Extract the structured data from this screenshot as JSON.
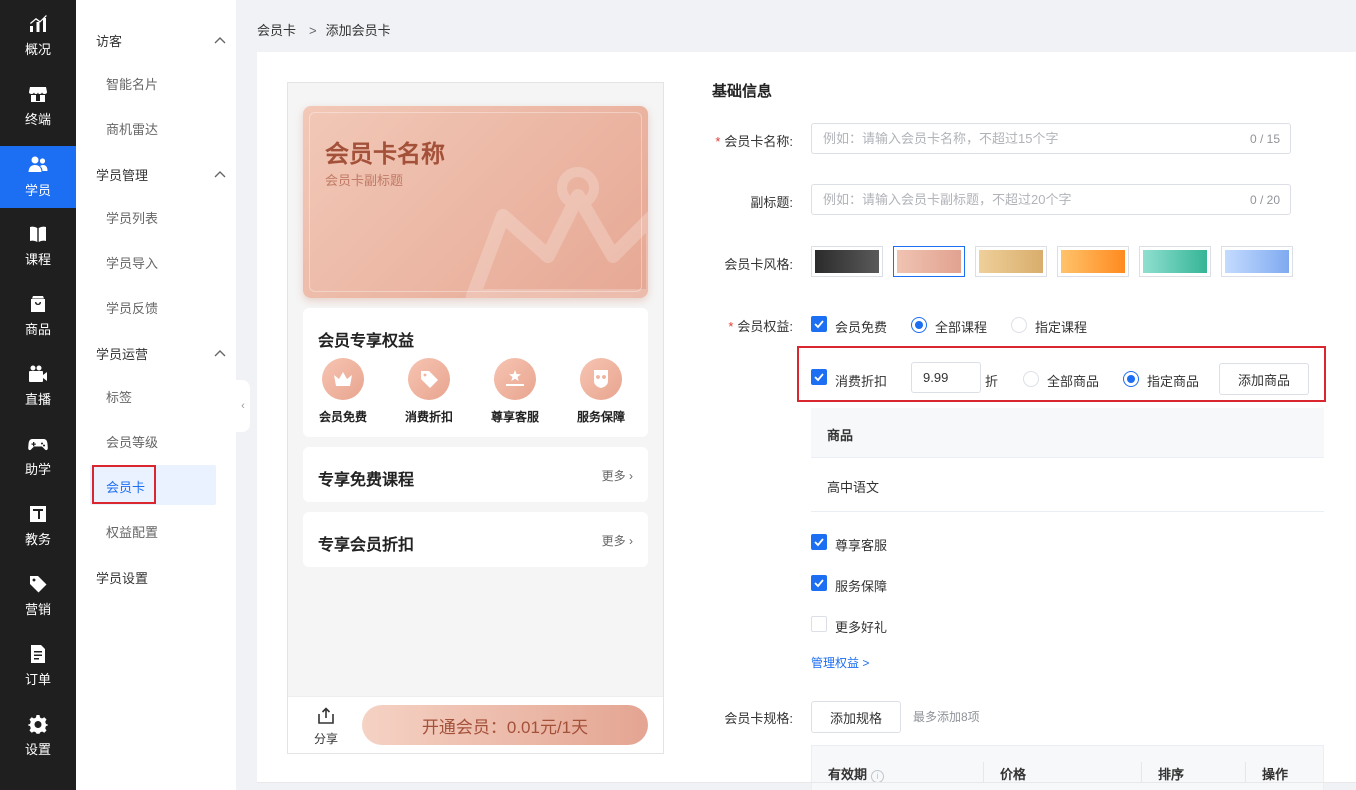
{
  "nav": {
    "items": [
      {
        "label": "概况",
        "icon": "chart-icon"
      },
      {
        "label": "终端",
        "icon": "store-icon"
      },
      {
        "label": "学员",
        "icon": "users-icon"
      },
      {
        "label": "课程",
        "icon": "book-icon"
      },
      {
        "label": "商品",
        "icon": "bag-icon"
      },
      {
        "label": "直播",
        "icon": "video-icon"
      },
      {
        "label": "助学",
        "icon": "gamepad-icon"
      },
      {
        "label": "教务",
        "icon": "board-icon"
      },
      {
        "label": "营销",
        "icon": "tag-icon"
      },
      {
        "label": "订单",
        "icon": "document-icon"
      },
      {
        "label": "设置",
        "icon": "gear-icon"
      }
    ],
    "active": "学员",
    "active_color": "#1c6ef2"
  },
  "submenu": {
    "group_visitor": "访客",
    "visitor_items": [
      "智能名片",
      "商机雷达"
    ],
    "group_student_mgmt": "学员管理",
    "mgmt_items": [
      "学员列表",
      "学员导入",
      "学员反馈"
    ],
    "group_student_ops": "学员运营",
    "ops_items": [
      "标签",
      "会员等级",
      "会员卡",
      "权益配置"
    ],
    "group_student_settings": "学员设置",
    "active": "会员卡"
  },
  "breadcrumb": {
    "parent": "会员卡",
    "current": "添加会员卡"
  },
  "preview": {
    "card_title": "会员卡名称",
    "card_subtitle": "会员卡副标题",
    "benefits_title": "会员专享权益",
    "benefits": [
      {
        "label": "会员免费",
        "icon": "vip-crown-icon"
      },
      {
        "label": "消费折扣",
        "icon": "discount-tag-icon"
      },
      {
        "label": "尊享客服",
        "icon": "service-icon"
      },
      {
        "label": "服务保障",
        "icon": "shield-icon"
      }
    ],
    "free_courses_title": "专享免费课程",
    "member_discount_title": "专享会员折扣",
    "more_label": "更多",
    "share_label": "分享",
    "open_button": "开通会员：0.01元/1天"
  },
  "form": {
    "section_title": "基础信息",
    "name_label": "会员卡名称:",
    "name_placeholder": "例如：请输入会员卡名称，不超过15个字",
    "name_count": "0 / 15",
    "subtitle_label": "副标题:",
    "subtitle_placeholder": "例如：请输入会员卡副标题，不超过20个字",
    "subtitle_count": "0 / 20",
    "style_label": "会员卡风格:",
    "styles": [
      {
        "from": "#2b2b2b",
        "to": "#5a5a5a"
      },
      {
        "from": "#f0c3b2",
        "to": "#e2a290"
      },
      {
        "from": "#eed09a",
        "to": "#d9ad6c"
      },
      {
        "from": "#ffc36b",
        "to": "#ff8a1f"
      },
      {
        "from": "#8fdfcf",
        "to": "#35b596"
      },
      {
        "from": "#c4dbff",
        "to": "#7faaf0"
      }
    ],
    "selected_style": 1,
    "rights_label": "会员权益:",
    "free_label": "会员免费",
    "free_checked": true,
    "all_courses": "全部课程",
    "specified_courses": "指定课程",
    "course_scope": "all",
    "discount_label": "消费折扣",
    "discount_checked": true,
    "discount_value": "9.99",
    "discount_unit": "折",
    "all_goods": "全部商品",
    "specified_goods": "指定商品",
    "goods_scope": "specified",
    "add_goods_button": "添加商品",
    "goods_table_header": "商品",
    "goods_rows": [
      "高中语文"
    ],
    "service_label": "尊享客服",
    "service_checked": true,
    "guarantee_label": "服务保障",
    "guarantee_checked": true,
    "gifts_label": "更多好礼",
    "gifts_checked": false,
    "manage_link": "管理权益 >",
    "spec_label": "会员卡规格:",
    "add_spec_button": "添加规格",
    "spec_hint": "最多添加8项",
    "spec_columns": [
      "有效期",
      "价格",
      "排序",
      "操作"
    ]
  }
}
